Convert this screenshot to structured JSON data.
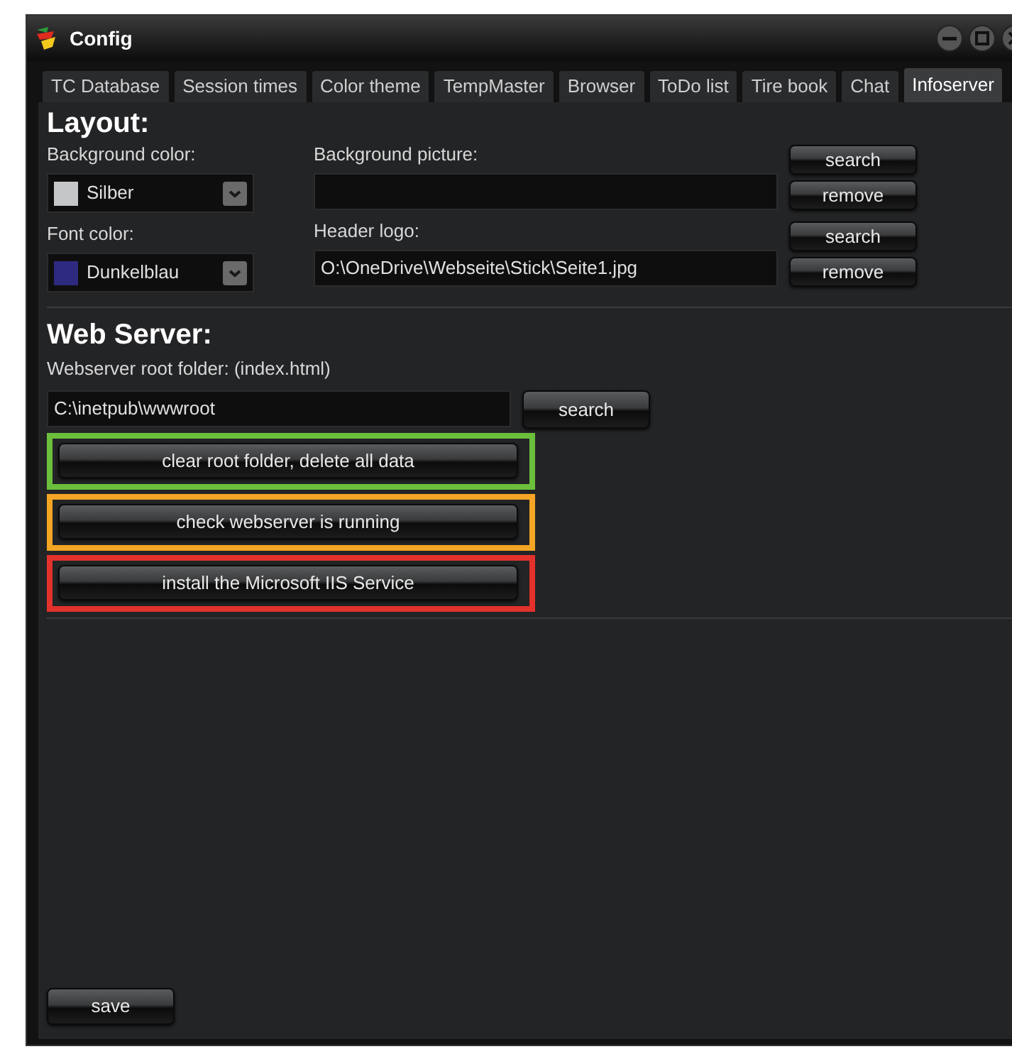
{
  "window": {
    "title": "Config"
  },
  "tabs": [
    {
      "label": "TC Database",
      "selected": false
    },
    {
      "label": "Session times",
      "selected": false
    },
    {
      "label": "Color theme",
      "selected": false
    },
    {
      "label": "TempMaster",
      "selected": false
    },
    {
      "label": "Browser",
      "selected": false
    },
    {
      "label": "ToDo list",
      "selected": false
    },
    {
      "label": "Tire book",
      "selected": false
    },
    {
      "label": "Chat",
      "selected": false
    },
    {
      "label": "Infoserver",
      "selected": true
    }
  ],
  "layout": {
    "heading": "Layout:",
    "color_settings": [
      {
        "label": "Background color:",
        "value": "Silber",
        "color": "#c4c6c8"
      },
      {
        "label": "Font color:",
        "value": "Dunkelblau",
        "color": "#2e2a80"
      }
    ],
    "file_settings": [
      {
        "label": "Background picture:",
        "buttons": [
          "search",
          "remove"
        ]
      },
      {
        "label": "Header logo:",
        "value": "O:\\OneDrive\\Webseite\\Stick\\Seite1.jpg",
        "buttons": [
          "search",
          "remove"
        ]
      }
    ]
  },
  "web_server": {
    "heading": "Web Server:",
    "folder_label": "Webserver root folder: (index.html)",
    "folder_value": "C:\\inetpub\\wwwroot",
    "search_button": "search",
    "actions": [
      {
        "label": "clear root folder, delete all data",
        "color": "#6bbf3b"
      },
      {
        "label": "check webserver is running",
        "color": "#f5a524"
      },
      {
        "label": "install the Microsoft IIS Service",
        "color": "#e3322b"
      }
    ]
  },
  "save_button": "save"
}
